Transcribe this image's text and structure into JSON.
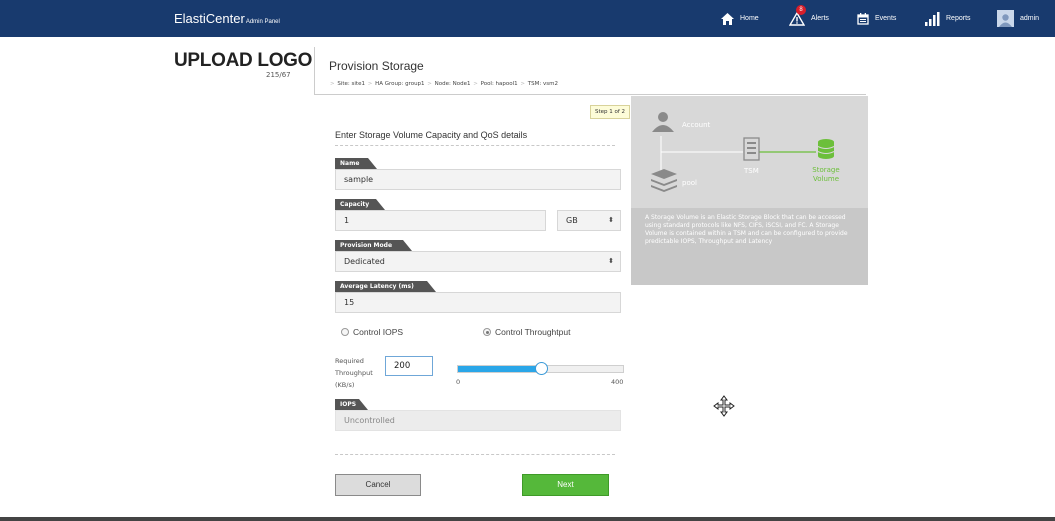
{
  "header": {
    "brand": "ElastiCenter",
    "brand_sub": "Admin Panel",
    "nav": {
      "home": "Home",
      "alerts": "Alerts",
      "alerts_count": "8",
      "events": "Events",
      "reports": "Reports",
      "user": "admin"
    }
  },
  "logo": {
    "title": "UPLOAD LOGO",
    "dims": "215/67"
  },
  "page": {
    "title": "Provision Storage",
    "breadcrumb": [
      "Site: site1",
      "HA Group: group1",
      "Node: Node1",
      "Pool: hapool1",
      "TSM: vsm2"
    ]
  },
  "form": {
    "step": "Step 1 of 2",
    "section_title": "Enter Storage Volume Capacity and QoS details",
    "name_label": "Name",
    "name_value": "sample",
    "capacity_label": "Capacity",
    "capacity_value": "1",
    "capacity_unit": "GB",
    "provision_label": "Provision Mode",
    "provision_value": "Dedicated",
    "latency_label": "Average Latency (ms)",
    "latency_value": "15",
    "radio_iops": "Control IOPS",
    "radio_throughput": "Control Throughtput",
    "selected_radio": "throughput",
    "throughput_label": "Required Throughput (KB/s)",
    "throughput_value": "200",
    "slider": {
      "min_label": "0",
      "max_label": "400",
      "min": 0,
      "max": 400,
      "value": 200
    },
    "iops_label": "IOPS",
    "iops_value": "Uncontrolled",
    "cancel": "Cancel",
    "next": "Next"
  },
  "info": {
    "account": "Account",
    "pool": "pool",
    "tsm": "TSM",
    "storage_volume_1": "Storage",
    "storage_volume_2": "Volume",
    "description": "A Storage Volume is an Elastic Storage Block that can be accessed using standard protocols like NFS, CIFS, iSCSI, and FC. A Storage Volume is contained within a TSM and can be configured to provide predictable IOPS, Throughput and Latency",
    "accent_color": "#6cbf3a"
  }
}
